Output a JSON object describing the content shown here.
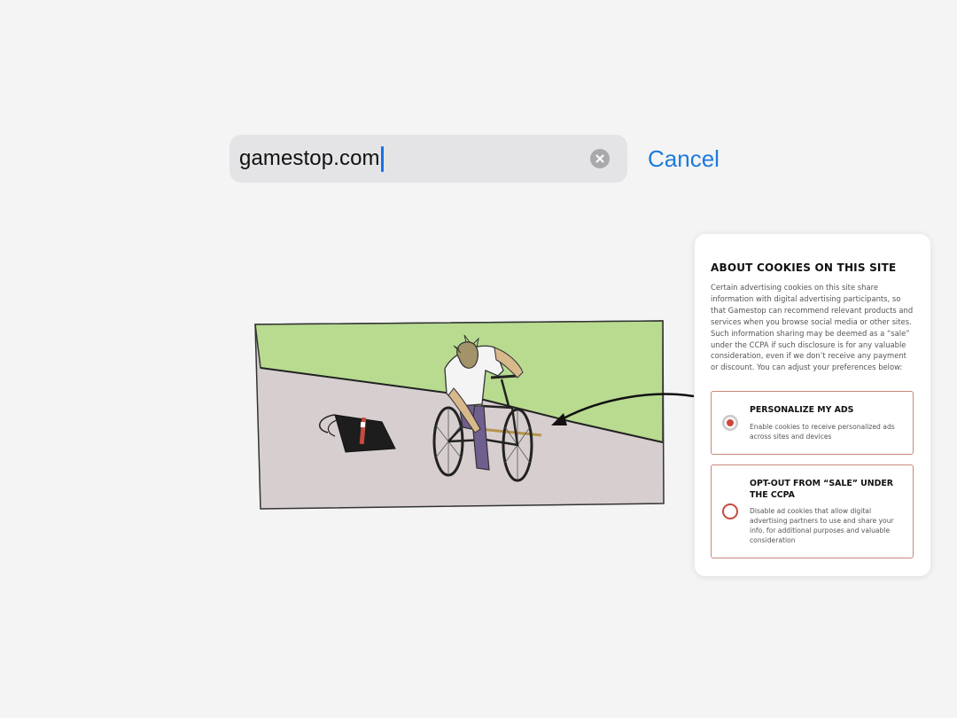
{
  "search": {
    "value": "gamestop.com",
    "cancel_label": "Cancel"
  },
  "meme": {
    "description_icon": "bike-stick-meme-image"
  },
  "cookie_panel": {
    "title": "ABOUT COOKIES ON THIS SITE",
    "body": "Certain advertising cookies on this site share information with digital advertising participants, so that Gamestop can recommend relevant products and services when you browse social media or other sites. Such information sharing may be deemed as a “sale” under the CCPA if such disclosure is for any valuable consideration, even if we don’t receive any payment or discount. You can adjust your preferences below:",
    "options": [
      {
        "title": "PERSONALIZE MY ADS",
        "description": "Enable cookies to receive personalized ads across sites and devices",
        "selected": true
      },
      {
        "title": "OPT-OUT FROM “SALE” UNDER THE CCPA",
        "description": "Disable ad cookies that allow digital advertising partners to use and share your info. for additional purposes and valuable consideration",
        "selected": false
      }
    ]
  },
  "colors": {
    "accent_blue": "#1d7ad9",
    "radio_red": "#d2443a",
    "card_border": "#c9877c",
    "grass_green": "#b8db90",
    "road_gray": "#d7cfcf"
  }
}
